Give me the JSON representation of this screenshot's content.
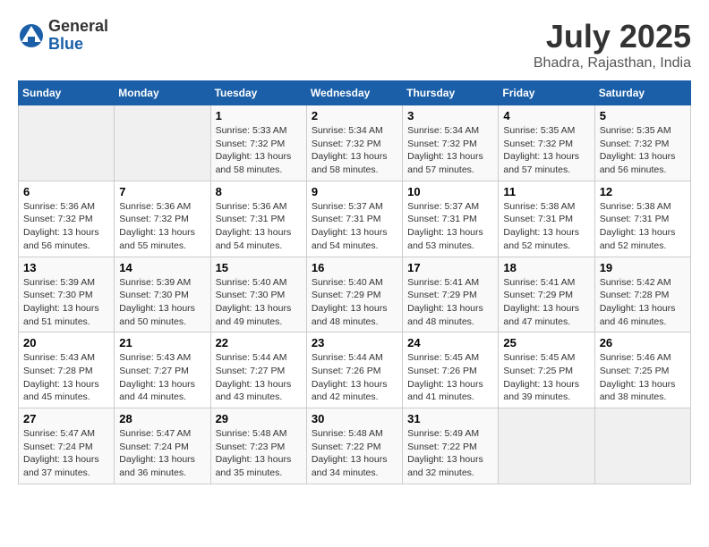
{
  "header": {
    "logo_general": "General",
    "logo_blue": "Blue",
    "title": "July 2025",
    "location": "Bhadra, Rajasthan, India"
  },
  "days_of_week": [
    "Sunday",
    "Monday",
    "Tuesday",
    "Wednesday",
    "Thursday",
    "Friday",
    "Saturday"
  ],
  "weeks": [
    [
      {
        "day": "",
        "empty": true
      },
      {
        "day": "",
        "empty": true
      },
      {
        "day": "1",
        "sunrise": "5:33 AM",
        "sunset": "7:32 PM",
        "daylight": "13 hours and 58 minutes."
      },
      {
        "day": "2",
        "sunrise": "5:34 AM",
        "sunset": "7:32 PM",
        "daylight": "13 hours and 58 minutes."
      },
      {
        "day": "3",
        "sunrise": "5:34 AM",
        "sunset": "7:32 PM",
        "daylight": "13 hours and 57 minutes."
      },
      {
        "day": "4",
        "sunrise": "5:35 AM",
        "sunset": "7:32 PM",
        "daylight": "13 hours and 57 minutes."
      },
      {
        "day": "5",
        "sunrise": "5:35 AM",
        "sunset": "7:32 PM",
        "daylight": "13 hours and 56 minutes."
      }
    ],
    [
      {
        "day": "6",
        "sunrise": "5:36 AM",
        "sunset": "7:32 PM",
        "daylight": "13 hours and 56 minutes."
      },
      {
        "day": "7",
        "sunrise": "5:36 AM",
        "sunset": "7:32 PM",
        "daylight": "13 hours and 55 minutes."
      },
      {
        "day": "8",
        "sunrise": "5:36 AM",
        "sunset": "7:31 PM",
        "daylight": "13 hours and 54 minutes."
      },
      {
        "day": "9",
        "sunrise": "5:37 AM",
        "sunset": "7:31 PM",
        "daylight": "13 hours and 54 minutes."
      },
      {
        "day": "10",
        "sunrise": "5:37 AM",
        "sunset": "7:31 PM",
        "daylight": "13 hours and 53 minutes."
      },
      {
        "day": "11",
        "sunrise": "5:38 AM",
        "sunset": "7:31 PM",
        "daylight": "13 hours and 52 minutes."
      },
      {
        "day": "12",
        "sunrise": "5:38 AM",
        "sunset": "7:31 PM",
        "daylight": "13 hours and 52 minutes."
      }
    ],
    [
      {
        "day": "13",
        "sunrise": "5:39 AM",
        "sunset": "7:30 PM",
        "daylight": "13 hours and 51 minutes."
      },
      {
        "day": "14",
        "sunrise": "5:39 AM",
        "sunset": "7:30 PM",
        "daylight": "13 hours and 50 minutes."
      },
      {
        "day": "15",
        "sunrise": "5:40 AM",
        "sunset": "7:30 PM",
        "daylight": "13 hours and 49 minutes."
      },
      {
        "day": "16",
        "sunrise": "5:40 AM",
        "sunset": "7:29 PM",
        "daylight": "13 hours and 48 minutes."
      },
      {
        "day": "17",
        "sunrise": "5:41 AM",
        "sunset": "7:29 PM",
        "daylight": "13 hours and 48 minutes."
      },
      {
        "day": "18",
        "sunrise": "5:41 AM",
        "sunset": "7:29 PM",
        "daylight": "13 hours and 47 minutes."
      },
      {
        "day": "19",
        "sunrise": "5:42 AM",
        "sunset": "7:28 PM",
        "daylight": "13 hours and 46 minutes."
      }
    ],
    [
      {
        "day": "20",
        "sunrise": "5:43 AM",
        "sunset": "7:28 PM",
        "daylight": "13 hours and 45 minutes."
      },
      {
        "day": "21",
        "sunrise": "5:43 AM",
        "sunset": "7:27 PM",
        "daylight": "13 hours and 44 minutes."
      },
      {
        "day": "22",
        "sunrise": "5:44 AM",
        "sunset": "7:27 PM",
        "daylight": "13 hours and 43 minutes."
      },
      {
        "day": "23",
        "sunrise": "5:44 AM",
        "sunset": "7:26 PM",
        "daylight": "13 hours and 42 minutes."
      },
      {
        "day": "24",
        "sunrise": "5:45 AM",
        "sunset": "7:26 PM",
        "daylight": "13 hours and 41 minutes."
      },
      {
        "day": "25",
        "sunrise": "5:45 AM",
        "sunset": "7:25 PM",
        "daylight": "13 hours and 39 minutes."
      },
      {
        "day": "26",
        "sunrise": "5:46 AM",
        "sunset": "7:25 PM",
        "daylight": "13 hours and 38 minutes."
      }
    ],
    [
      {
        "day": "27",
        "sunrise": "5:47 AM",
        "sunset": "7:24 PM",
        "daylight": "13 hours and 37 minutes."
      },
      {
        "day": "28",
        "sunrise": "5:47 AM",
        "sunset": "7:24 PM",
        "daylight": "13 hours and 36 minutes."
      },
      {
        "day": "29",
        "sunrise": "5:48 AM",
        "sunset": "7:23 PM",
        "daylight": "13 hours and 35 minutes."
      },
      {
        "day": "30",
        "sunrise": "5:48 AM",
        "sunset": "7:22 PM",
        "daylight": "13 hours and 34 minutes."
      },
      {
        "day": "31",
        "sunrise": "5:49 AM",
        "sunset": "7:22 PM",
        "daylight": "13 hours and 32 minutes."
      },
      {
        "day": "",
        "empty": true
      },
      {
        "day": "",
        "empty": true
      }
    ]
  ],
  "labels": {
    "sunrise_prefix": "Sunrise: ",
    "sunset_prefix": "Sunset: ",
    "daylight_prefix": "Daylight: "
  }
}
